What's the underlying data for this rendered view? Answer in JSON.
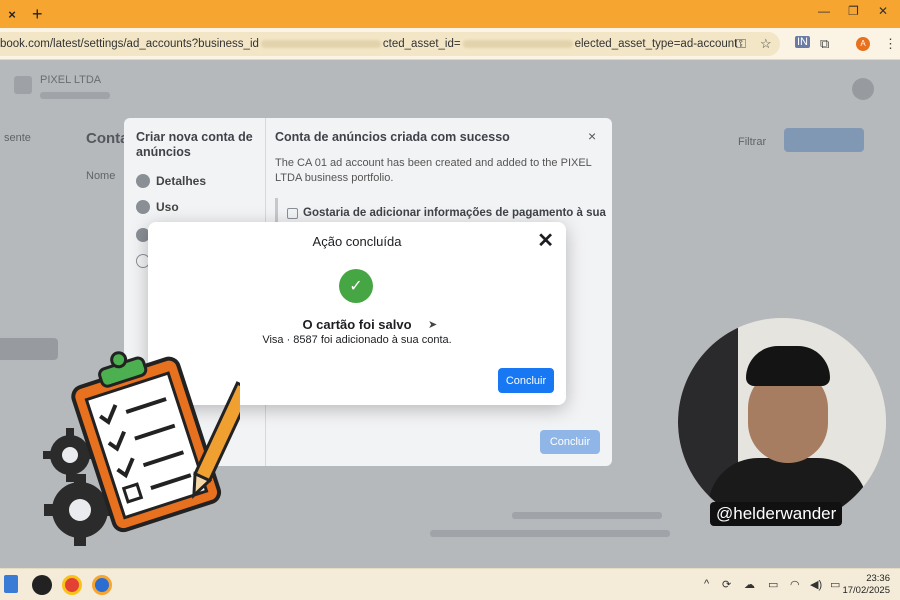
{
  "browser": {
    "tab_close": "×",
    "new_tab": "+",
    "window_controls": [
      "—",
      "❐",
      "✕"
    ],
    "url_prefix": "book.com/latest/settings/ad_accounts?business_id",
    "url_mid": "cted_asset_id=",
    "url_suffix": "elected_asset_type=ad-account",
    "profile_initial": "A"
  },
  "background": {
    "business_name": "PIXEL LTDA",
    "page_title": "Conta",
    "left_panel_title": "Criar nova conta de anúncios",
    "steps": [
      "Detalhes",
      "Uso",
      "",
      ""
    ],
    "right_panel_title": "Conta de anúncios criada com sucesso",
    "right_panel_desc": "The CA 01 ad account has been created and added to the PIXEL LTDA business portfolio.",
    "checkbox_label": "Gostaria de adicionar informações de pagamento à sua",
    "filter_label": "Filtrar",
    "done_label": "Concluir"
  },
  "dialog": {
    "title": "Ação concluída",
    "heading": "O cartão foi salvo",
    "body": "Visa · 8587 foi adicionado à sua conta.",
    "button": "Concluir"
  },
  "overlay": {
    "handle": "@helderwander"
  },
  "taskbar": {
    "time": "23:36",
    "date": "17/02/2025"
  },
  "colors": {
    "accent": "#1877f2",
    "success": "#45a643",
    "tab_bar": "#f7a531"
  }
}
